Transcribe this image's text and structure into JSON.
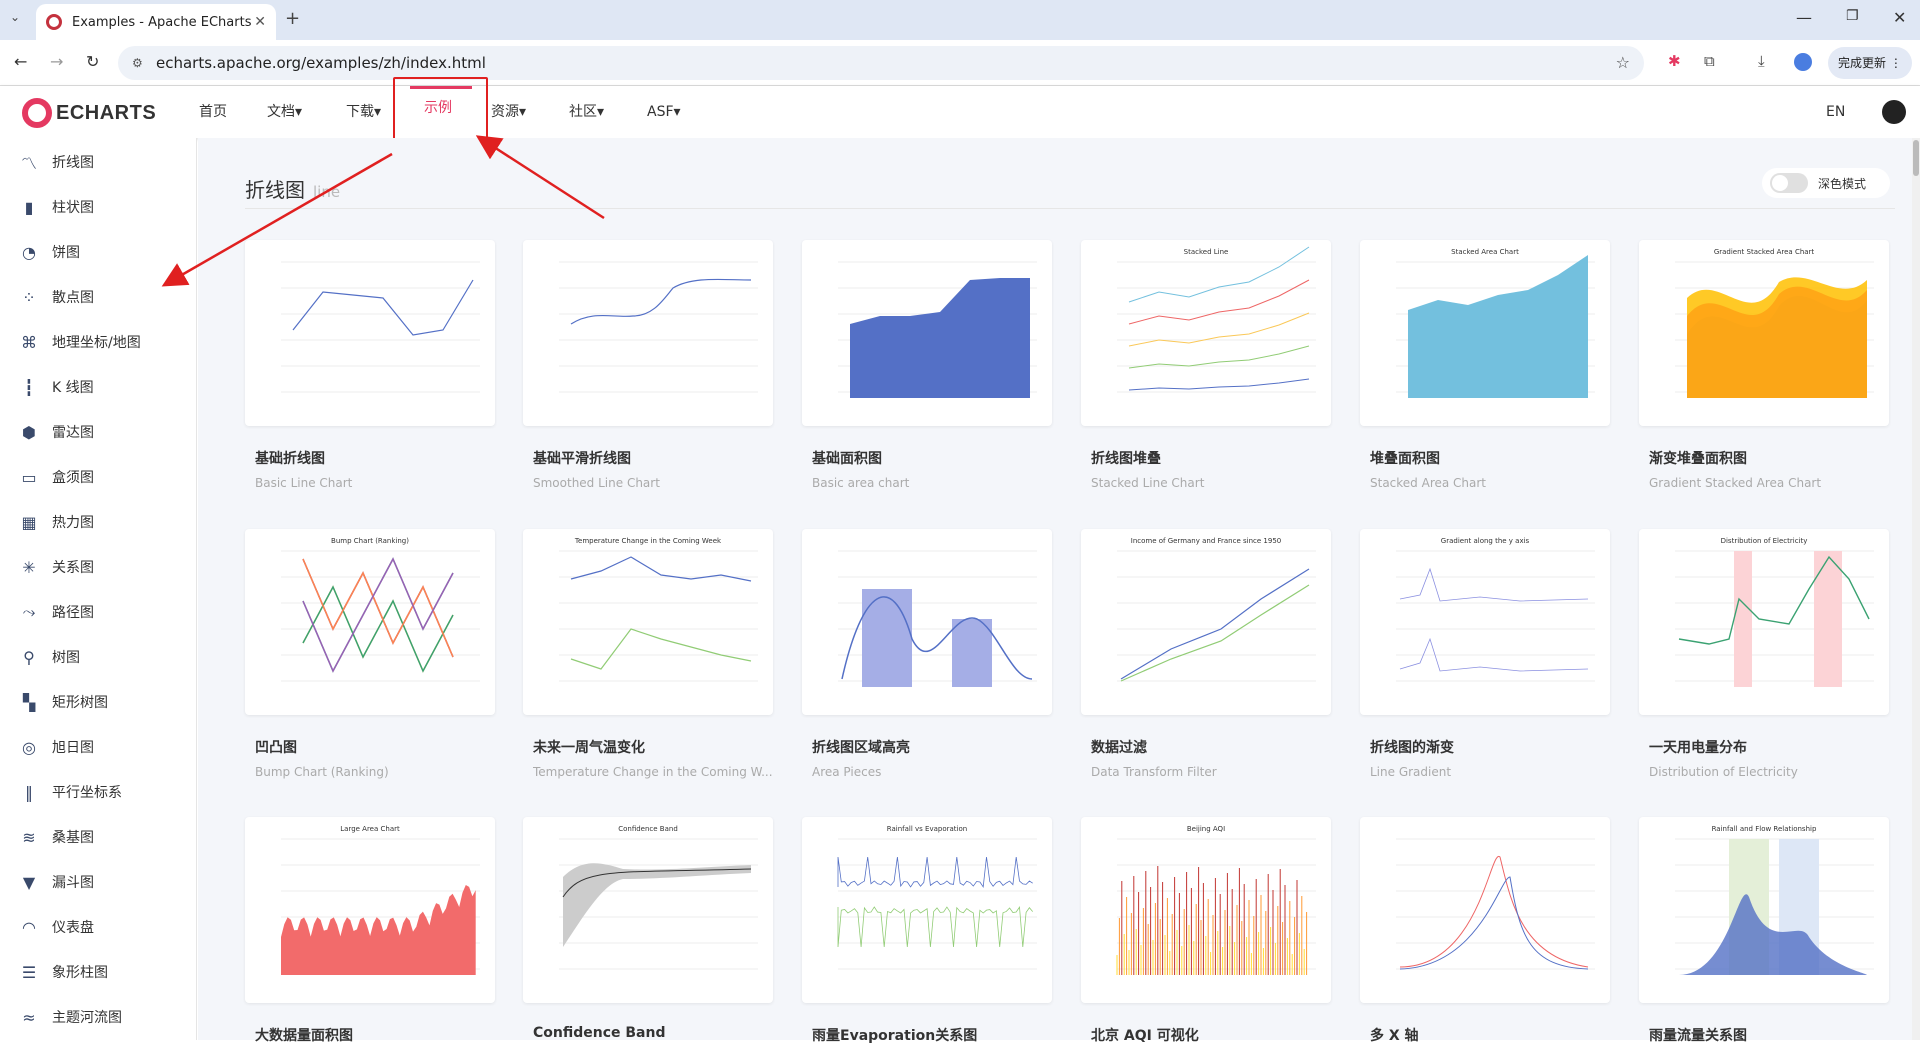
{
  "browser": {
    "tab_title": "Examples - Apache ECharts",
    "url": "echarts.apache.org/examples/zh/index.html",
    "update_label": "完成更新"
  },
  "nav": {
    "logo": "ECHARTS",
    "items": [
      "首页",
      "文档▾",
      "下载▾",
      "示例",
      "资源▾",
      "社区▾",
      "ASF▾"
    ],
    "lang": "EN"
  },
  "sidebar": {
    "items": [
      {
        "label": "折线图",
        "icon": "line-chart-icon"
      },
      {
        "label": "柱状图",
        "icon": "bar-chart-icon"
      },
      {
        "label": "饼图",
        "icon": "pie-chart-icon"
      },
      {
        "label": "散点图",
        "icon": "scatter-icon"
      },
      {
        "label": "地理坐标/地图",
        "icon": "map-icon"
      },
      {
        "label": "K 线图",
        "icon": "candlestick-icon"
      },
      {
        "label": "雷达图",
        "icon": "radar-icon"
      },
      {
        "label": "盒须图",
        "icon": "boxplot-icon"
      },
      {
        "label": "热力图",
        "icon": "heatmap-icon"
      },
      {
        "label": "关系图",
        "icon": "graph-icon"
      },
      {
        "label": "路径图",
        "icon": "lines-icon"
      },
      {
        "label": "树图",
        "icon": "tree-icon"
      },
      {
        "label": "矩形树图",
        "icon": "treemap-icon"
      },
      {
        "label": "旭日图",
        "icon": "sunburst-icon"
      },
      {
        "label": "平行坐标系",
        "icon": "parallel-icon"
      },
      {
        "label": "桑基图",
        "icon": "sankey-icon"
      },
      {
        "label": "漏斗图",
        "icon": "funnel-icon"
      },
      {
        "label": "仪表盘",
        "icon": "gauge-icon"
      },
      {
        "label": "象形柱图",
        "icon": "pictorial-bar-icon"
      },
      {
        "label": "主题河流图",
        "icon": "theme-river-icon"
      }
    ]
  },
  "section": {
    "title": "折线图",
    "subtitle": "line",
    "dark_mode_label": "深色模式"
  },
  "cards": [
    {
      "title": "基础折线图",
      "subtitle": "Basic Line Chart",
      "kind": "line"
    },
    {
      "title": "基础平滑折线图",
      "subtitle": "Smoothed Line Chart",
      "kind": "smooth"
    },
    {
      "title": "基础面积图",
      "subtitle": "Basic area chart",
      "kind": "area"
    },
    {
      "title": "折线图堆叠",
      "subtitle": "Stacked Line Chart",
      "kind": "stacked-line",
      "thumb_title": "Stacked Line"
    },
    {
      "title": "堆叠面积图",
      "subtitle": "Stacked Area Chart",
      "kind": "stacked-area",
      "thumb_title": "Stacked Area Chart"
    },
    {
      "title": "渐变堆叠面积图",
      "subtitle": "Gradient Stacked Area Chart",
      "kind": "gradient-area",
      "thumb_title": "Gradient Stacked Area Chart"
    },
    {
      "title": "凹凸图",
      "subtitle": "Bump Chart (Ranking)",
      "kind": "bump",
      "thumb_title": "Bump Chart (Ranking)"
    },
    {
      "title": "未来一周气温变化",
      "subtitle": "Temperature Change in the Coming W...",
      "kind": "temp",
      "thumb_title": "Temperature Change in the Coming Week"
    },
    {
      "title": "折线图区域高亮",
      "subtitle": "Area Pieces",
      "kind": "pieces"
    },
    {
      "title": "数据过滤",
      "subtitle": "Data Transform Filter",
      "kind": "filter",
      "thumb_title": "Income of Germany and France since 1950"
    },
    {
      "title": "折线图的渐变",
      "subtitle": "Line Gradient",
      "kind": "gradient",
      "thumb_title": "Gradient along the y axis"
    },
    {
      "title": "一天用电量分布",
      "subtitle": "Distribution of Electricity",
      "kind": "electric",
      "thumb_title": "Distribution of Electricity"
    },
    {
      "title": "大数据量面积图",
      "subtitle": "",
      "kind": "large",
      "thumb_title": "Large Area Chart"
    },
    {
      "title": "Confidence Band",
      "subtitle": "",
      "kind": "band",
      "thumb_title": "Confidence Band"
    },
    {
      "title": "雨量Evaporation关系图",
      "subtitle": "",
      "kind": "rain",
      "thumb_title": "Rainfall vs Evaporation"
    },
    {
      "title": "北京 AQI 可视化",
      "subtitle": "",
      "kind": "aqi",
      "thumb_title": "Beijing AQI"
    },
    {
      "title": "多 X 轴",
      "subtitle": "",
      "kind": "multix"
    },
    {
      "title": "雨量流量关系图",
      "subtitle": "",
      "kind": "flow",
      "thumb_title": "Rainfall and Flow Relationship"
    }
  ]
}
